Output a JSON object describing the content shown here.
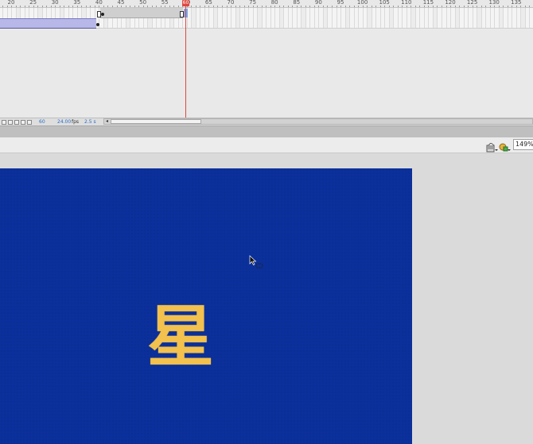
{
  "timeline": {
    "ruler_labels": [
      "20",
      "25",
      "30",
      "35",
      "40",
      "45",
      "50",
      "55",
      "60",
      "65",
      "70",
      "75",
      "80",
      "85",
      "90",
      "95",
      "100",
      "105",
      "110",
      "115",
      "120",
      "125",
      "130",
      "135"
    ],
    "playhead_frame": "60",
    "status": {
      "current_frame": "60",
      "fps": "24.00",
      "fps_unit": "fps",
      "elapsed_time": "2.5 s"
    }
  },
  "edit_bar": {
    "zoom": "149%"
  },
  "stage": {
    "character": "星",
    "background_color": "#0b309b",
    "text_color": "#f2c14e"
  },
  "icons": {
    "edit_symbols": "edit-symbols-icon",
    "edit_scene": "edit-scene-icon",
    "cursor": "move-cursor-icon"
  }
}
